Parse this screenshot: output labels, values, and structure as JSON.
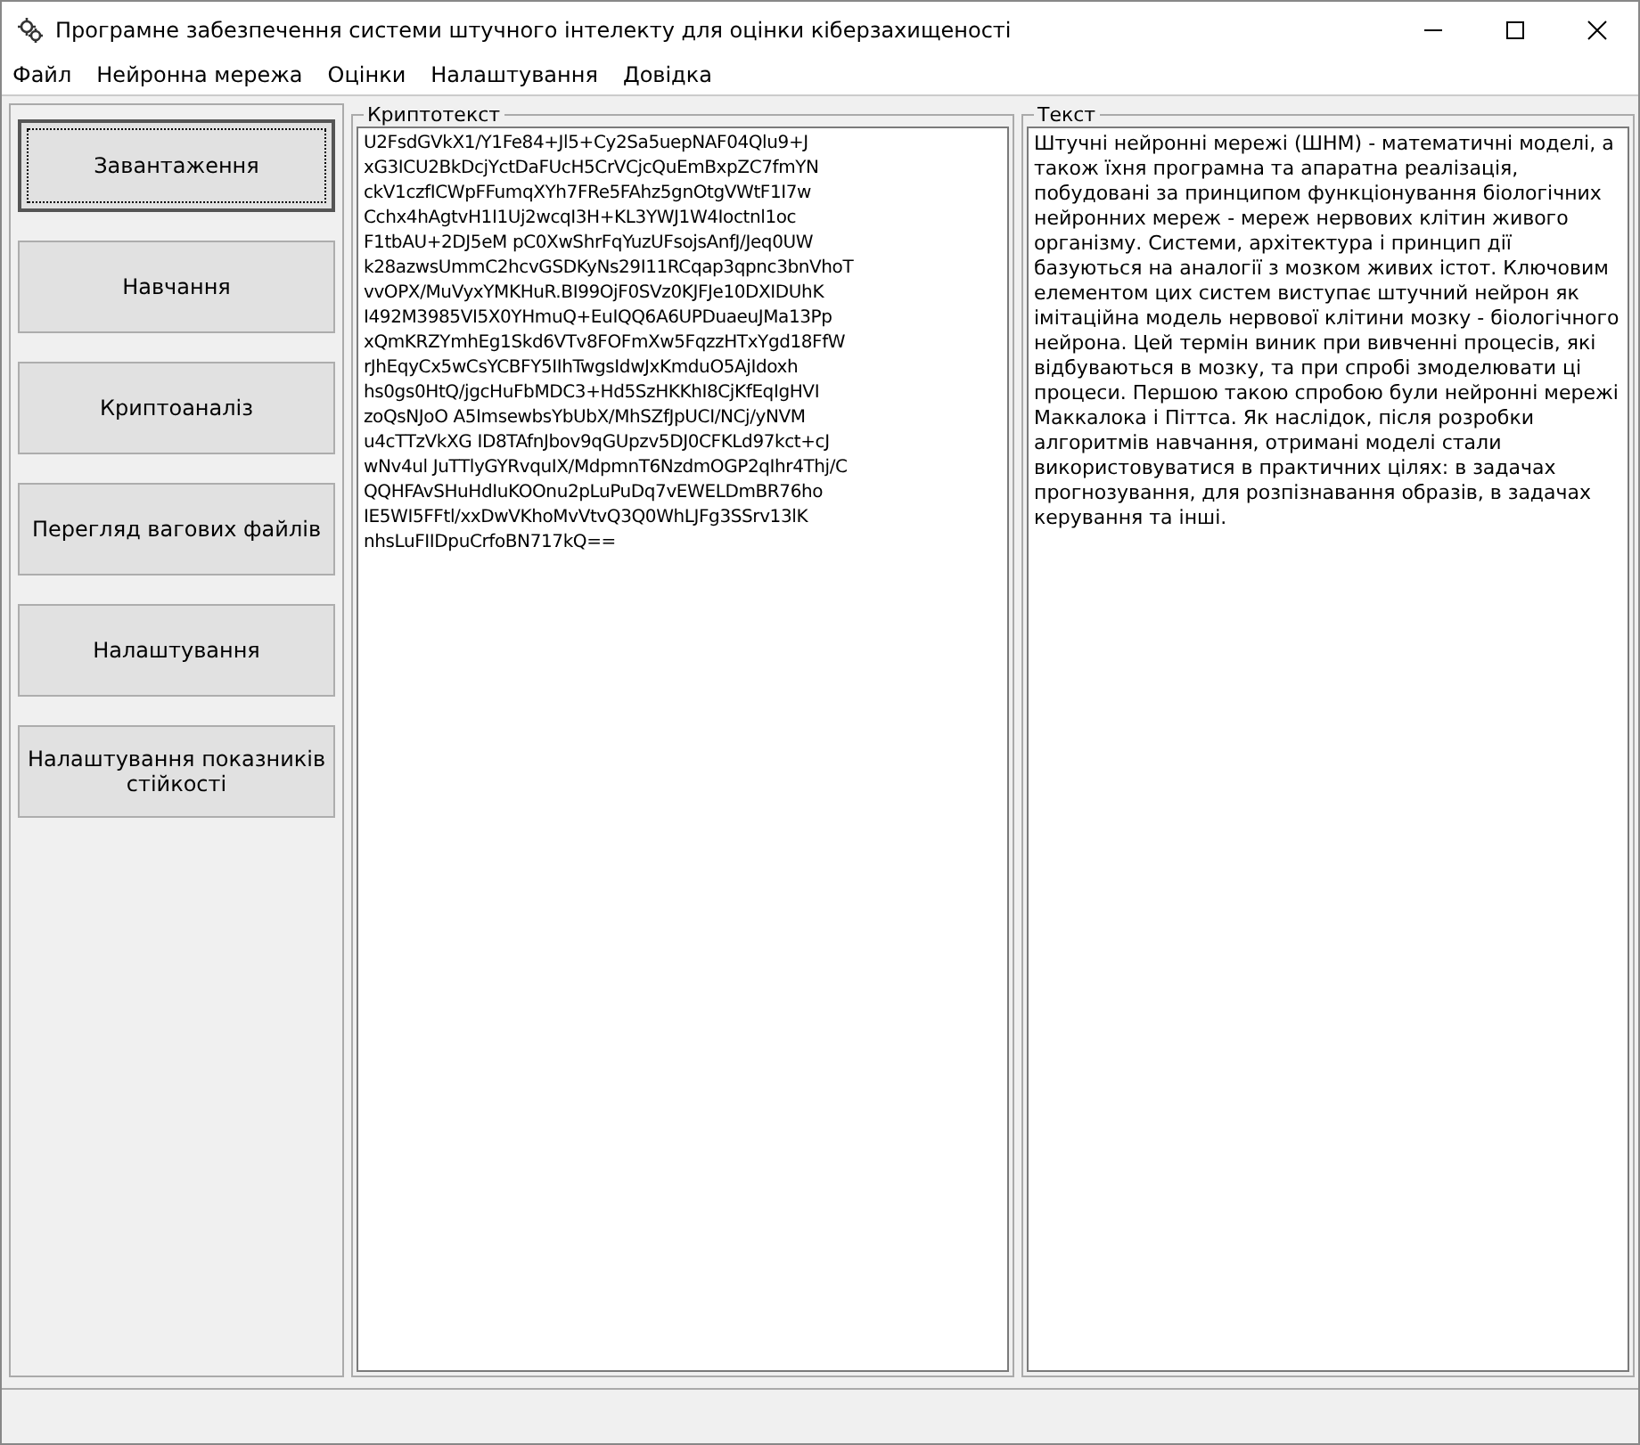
{
  "window": {
    "title": "Програмне забезпечення системи штучного інтелекту для оцінки кіберзахищеності"
  },
  "menu": [
    "Файл",
    "Нейронна мережа",
    "Оцінки",
    "Налаштування",
    "Довідка"
  ],
  "buttons": [
    {
      "label": "Завантаження",
      "focused": true
    },
    {
      "label": "Навчання",
      "focused": false
    },
    {
      "label": "Криптоаналіз",
      "focused": false
    },
    {
      "label": "Перегляд вагових файлів",
      "focused": false
    },
    {
      "label": "Налаштування",
      "focused": false
    },
    {
      "label": "Налаштування показників стійкості",
      "focused": false
    }
  ],
  "ciphertext": {
    "title": "Криптотекст",
    "lines": [
      "U2FsdGVkX1/Y1Fe84+Jl5+Cy2Sa5uepNAF04Qlu9+J",
      "xG3ICU2BkDcjYctDaFUcH5CrVCjcQuEmBxpZC7fmYN",
      "ckV1czfICWpFFumqXYh7FRe5FAhz5gnOtgVWtF1I7w",
      "Cchx4hAgtvH1I1Uj2wcqI3H+KL3YWJ1W4Ioctnl1oc",
      "F1tbAU+2DJ5eM pC0XwShrFqYuzUFsojsAnfJ/Jeq0UW",
      "k28azwsUmmC2hcvGSDKyNs29I11RCqap3qpnc3bnVhoT",
      "vvOPX/MuVyxYMKHuR.BI99OjF0SVz0KJFJe10DXIDUhK",
      "I492M3985VI5X0YHmuQ+EuIQQ6A6UPDuaeuJMa13Pp",
      "xQmKRZYmhEg1Skd6VTv8FOFmXw5FqzzHTxYgd18FfW",
      "rJhEqyCx5wCsYCBFY5IIhTwgsIdwJxKmduO5AjIdoxh",
      "hs0gs0HtQ/jgcHuFbMDC3+Hd5SzHKKhI8CjKfEqIgHVI",
      "zoQsNJoO A5ImsewbsYbUbX/MhSZfJpUCI/NCj/yNVM",
      "u4cTTzVkXG ID8TAfnJbov9qGUpzv5DJ0CFKLd97kct+cJ",
      "wNv4ul JuTTlyGYRvquIX/MdpmnT6NzdmOGP2qIhr4Thj/C",
      "QQHFAvSHuHdIuKOOnu2pLuPuDq7vEWELDmBR76ho",
      "IE5WI5FFtl/xxDwVKhoMvVtvQ3Q0WhLJFg3SSrv13lK",
      "nhsLuFIIDpuCrfoBN717kQ=="
    ]
  },
  "plaintext": {
    "title": "Текст",
    "text": "Штучні нейронні мережі (ШНМ) - математичні моделі, а також їхня програмна та апаратна реалізація, побудовані за принципом функціонування біологічних нейронних мереж - мереж нервових клітин живого організму. Системи, архітектура і принцип дії базуються на аналогії з мозком живих істот. Ключовим елементом цих систем виступає штучний нейрон як імітаційна модель нервової клітини мозку - біологічного нейрона. Цей термін виник при вивченні процесів, які відбуваються в мозку, та при спробі змоделювати ці процеси. Першою такою спробою були нейронні мережі Маккалока і Піттса. Як наслідок, після розробки алгоритмів навчання, отримані моделі стали використовуватися в практичних цілях: в задачах прогнозування, для розпізнавання образів, в задачах керування та інші."
  }
}
